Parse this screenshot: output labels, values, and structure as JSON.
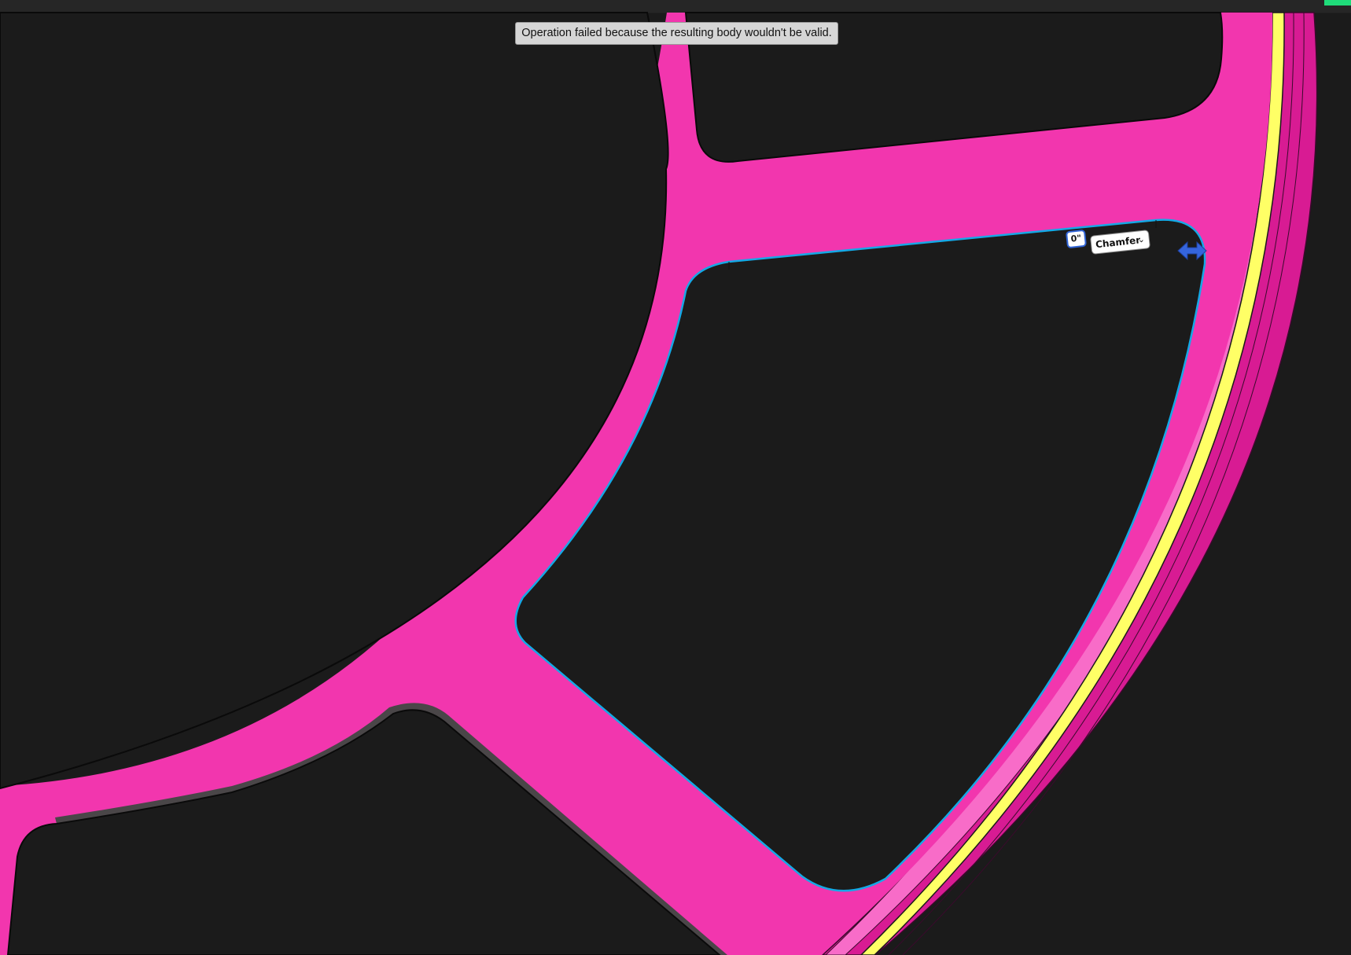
{
  "notification": {
    "message": "Operation failed because the resulting body wouldn't be valid."
  },
  "chamfer_manipulator": {
    "angle_value": "0\"",
    "type_label": "Chamfer",
    "dropdown_icon": "chevron-down-icon",
    "handle_icon": "double-arrow-icon"
  },
  "colors": {
    "viewport_background": "#1b1b1b",
    "body_face": "#f236ae",
    "rim_dark": "#d81b93",
    "rim_light": "#f86cc8",
    "rim_stripe": "#ffff66",
    "selected_edge": "#15a9e6",
    "handle": "#3565dd",
    "status_indicator": "#1fdc7a"
  }
}
